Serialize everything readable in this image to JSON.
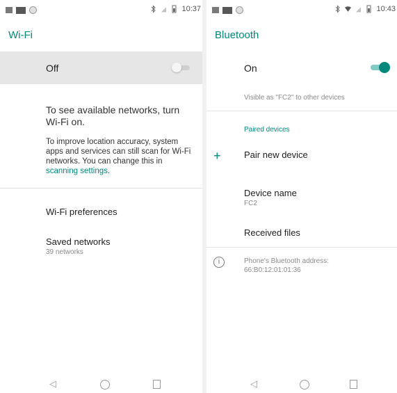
{
  "wifi": {
    "status": {
      "time": "10:37"
    },
    "title": "Wi-Fi",
    "toggle": {
      "label": "Off",
      "state": "off"
    },
    "message_big": "To see available networks, turn Wi-Fi on.",
    "message_small_before": "To improve location accuracy, system apps and services can still scan for Wi-Fi networks. You can change this in ",
    "message_small_link": "scanning settings",
    "message_small_after": ".",
    "preferences_label": "Wi-Fi preferences",
    "saved": {
      "title": "Saved networks",
      "subtitle": "39 networks"
    }
  },
  "bluetooth": {
    "status": {
      "time": "10:43"
    },
    "title": "Bluetooth",
    "toggle": {
      "label": "On",
      "state": "on"
    },
    "visibility": "Visible as \"FC2\" to other devices",
    "section_paired": "Paired devices",
    "pair_new": "Pair new device",
    "device_name": {
      "title": "Device name",
      "value": "FC2"
    },
    "received_files": "Received files",
    "address": {
      "label": "Phone's Bluetooth address:",
      "value": "66:B0:12:01:01:36"
    }
  },
  "icons": {
    "status_left": [
      "notification-icon",
      "image-icon",
      "circle-icon"
    ],
    "status_right": [
      "bluetooth-icon",
      "wifi-icon",
      "signal-icon",
      "battery-icon"
    ],
    "nav": [
      "back-icon",
      "home-icon",
      "recents-icon"
    ]
  },
  "colors": {
    "accent": "#00897b",
    "off_bg": "#e6e6e6"
  }
}
